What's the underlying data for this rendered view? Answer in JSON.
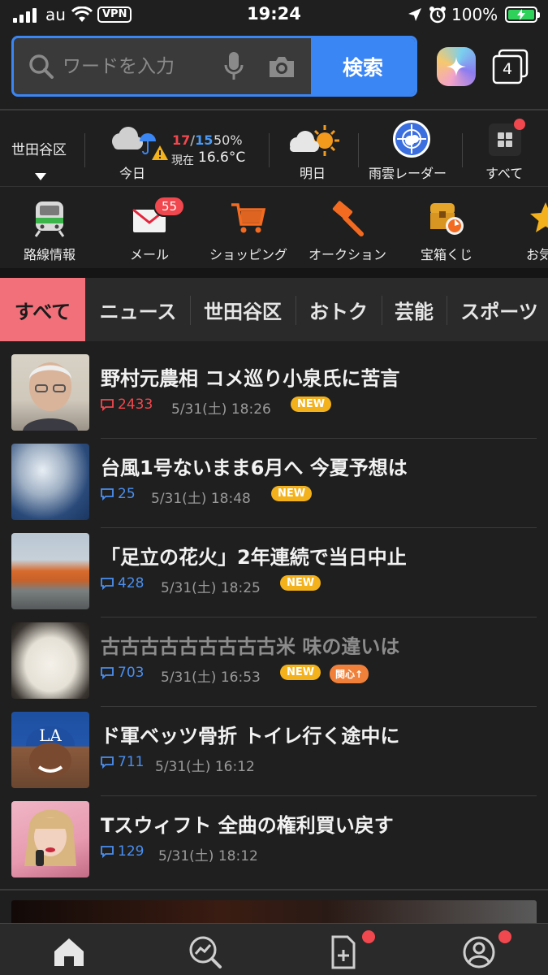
{
  "status_bar": {
    "carrier": "au",
    "vpn": "VPN",
    "time": "19:24",
    "battery": "100%",
    "signal_bars": 4
  },
  "search": {
    "placeholder": "ワードを入力",
    "button_label": "検索",
    "tab_count": "4"
  },
  "weather": {
    "location": "世田谷区",
    "today_label": "今日",
    "high": "17",
    "slash": "/",
    "low": "15",
    "rain_pct": "50%",
    "now_label": "現在",
    "now_temp": "16.6°C",
    "tomorrow_label": "明日",
    "radar_label": "雨雲レーダー",
    "all_label": "すべて"
  },
  "services": [
    {
      "label": "路線情報",
      "icon": "train-icon"
    },
    {
      "label": "メール",
      "icon": "mail-icon",
      "badge": "55"
    },
    {
      "label": "ショッピング",
      "icon": "cart-icon"
    },
    {
      "label": "オークション",
      "icon": "auction-hammer-icon"
    },
    {
      "label": "宝箱くじ",
      "icon": "treasure-box-icon"
    },
    {
      "label": "お気に",
      "icon": "star-icon"
    }
  ],
  "categories": [
    "すべて",
    "ニュース",
    "世田谷区",
    "おトク",
    "芸能",
    "スポーツ"
  ],
  "news": [
    {
      "title": "野村元農相 コメ巡り小泉氏に苦言",
      "comments": "2433",
      "date": "5/31(土) 18:26",
      "new": "NEW",
      "hot": true
    },
    {
      "title": "台風1号ないまま6月へ 今夏予想は",
      "comments": "25",
      "date": "5/31(土) 18:48",
      "new": "NEW"
    },
    {
      "title": "「足立の花火」2年連続で当日中止",
      "comments": "428",
      "date": "5/31(土) 18:25",
      "new": "NEW"
    },
    {
      "title": "古古古古古古古古古米 味の違いは",
      "comments": "703",
      "date": "5/31(土) 16:53",
      "new": "NEW",
      "interest": "関心↑",
      "read": true
    },
    {
      "title": "ド軍ベッツ骨折 トイレ行く途中に",
      "comments": "711",
      "date": "5/31(土) 16:12"
    },
    {
      "title": "Tスウィフト 全曲の権利買い戻す",
      "comments": "129",
      "date": "5/31(土) 18:12"
    }
  ],
  "colors": {
    "accent": "#3b86f5",
    "active_tab": "#f2707a",
    "new_badge": "#f3b11c",
    "alert": "#f0484e"
  }
}
